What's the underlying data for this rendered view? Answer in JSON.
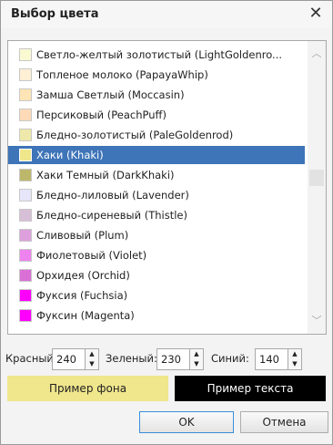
{
  "window": {
    "title": "Выбор цвета",
    "close_glyph": "✕"
  },
  "color_list": {
    "items": [
      {
        "label": "Светло-желтый золотистый (LightGoldenro...",
        "color": "#FAFAD2"
      },
      {
        "label": "Топленое молоко (PapayaWhip)",
        "color": "#FFEFD5"
      },
      {
        "label": "Замша Светлый (Moccasin)",
        "color": "#FFE4B5"
      },
      {
        "label": "Персиковый (PeachPuff)",
        "color": "#FFDAB9"
      },
      {
        "label": "Бледно-золотистый (PaleGoldenrod)",
        "color": "#EEE8AA"
      },
      {
        "label": "Хаки (Khaki)",
        "color": "#F0E68C",
        "selected": true
      },
      {
        "label": "Хаки Темный (DarkKhaki)",
        "color": "#BDB76B"
      },
      {
        "label": "Бледно-лиловый (Lavender)",
        "color": "#E6E6FA"
      },
      {
        "label": "Бледно-сиреневый (Thistle)",
        "color": "#D8BFD8"
      },
      {
        "label": "Сливовый (Plum)",
        "color": "#DDA0DD"
      },
      {
        "label": "Фиолетовый (Violet)",
        "color": "#EE82EE"
      },
      {
        "label": "Орхидея (Orchid)",
        "color": "#DA70D6"
      },
      {
        "label": "Фуксия (Fuchsia)",
        "color": "#FF00FF"
      },
      {
        "label": "Фуксин (Magenta)",
        "color": "#FF00FF"
      }
    ],
    "selection_color": "#3E74B8",
    "scroll_up_icon": "chevron-up-icon",
    "scroll_down_icon": "chevron-down-icon"
  },
  "rgb": {
    "red_label": "Красный:",
    "red_value": "240",
    "green_label": "Зеленый:",
    "green_value": "230",
    "blue_label": "Синий:",
    "blue_value": "140"
  },
  "preview": {
    "background_label": "Пример фона",
    "background_color": "#F0E68C",
    "text_label": "Пример текста",
    "text_color": "#FFFFFF",
    "text_bg_color": "#000000"
  },
  "buttons": {
    "ok": "OK",
    "cancel": "Отмена"
  }
}
